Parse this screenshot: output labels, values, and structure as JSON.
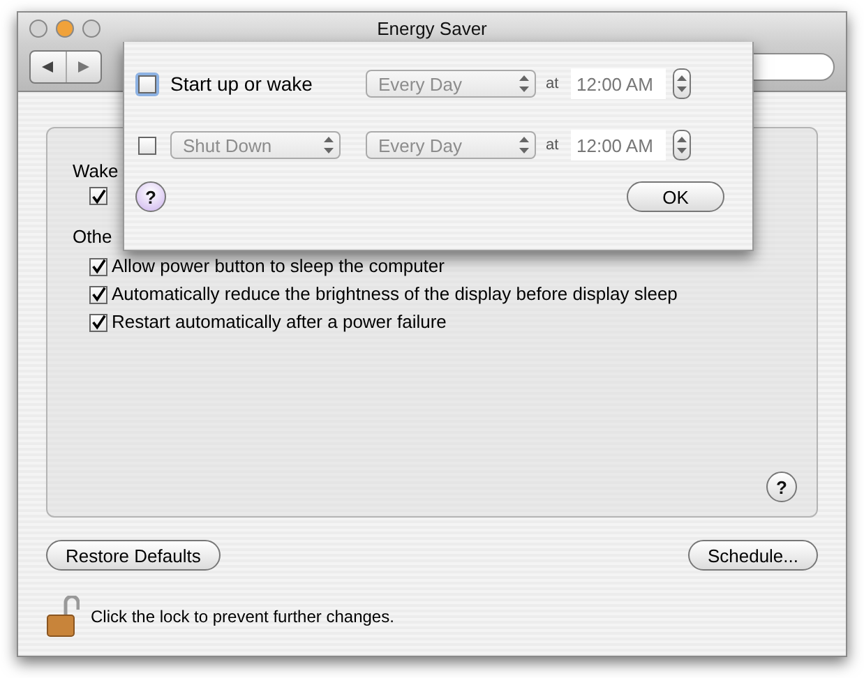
{
  "window": {
    "title": "Energy Saver"
  },
  "wake_options": {
    "label": "Wake",
    "items": [
      {
        "checked": true
      }
    ]
  },
  "other_options": {
    "label": "Othe",
    "items": [
      {
        "label": "Allow power button to sleep the computer",
        "checked": true
      },
      {
        "label": "Automatically reduce the brightness of the display before display sleep",
        "checked": true
      },
      {
        "label": "Restart automatically after a power failure",
        "checked": true
      }
    ]
  },
  "panel_help": "?",
  "buttons": {
    "restore": "Restore Defaults",
    "schedule": "Schedule..."
  },
  "lock": {
    "locked": false,
    "message": "Click the lock to prevent further changes."
  },
  "schedule_sheet": {
    "rows": [
      {
        "kind": "labeled",
        "checked": false,
        "focused": true,
        "label": "Start up or wake",
        "repeat": "Every Day",
        "at_label": "at",
        "time": "12:00 AM"
      },
      {
        "kind": "popup",
        "checked": false,
        "focused": false,
        "action": "Shut Down",
        "repeat": "Every Day",
        "at_label": "at",
        "time": "12:00 AM"
      }
    ],
    "help": "?",
    "ok": "OK"
  }
}
